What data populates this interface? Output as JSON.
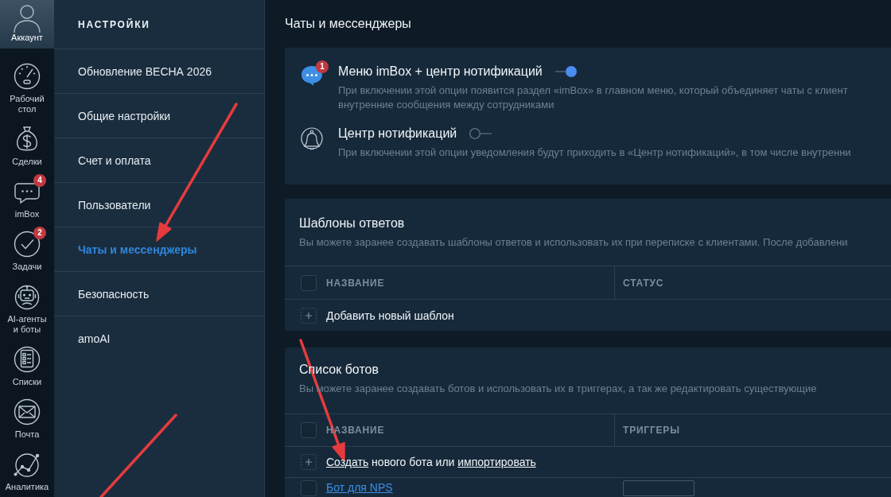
{
  "rail": {
    "account": {
      "label": "Аккаунт"
    },
    "items": [
      {
        "kind": "dashboard",
        "label": "Рабочий стол"
      },
      {
        "kind": "deals",
        "label": "Сделки"
      },
      {
        "kind": "chats",
        "label": "imBox",
        "badge": "4"
      },
      {
        "kind": "tasks",
        "label": "Задачи",
        "badge": "2"
      },
      {
        "kind": "ai",
        "label": "AI-агенты и боты"
      },
      {
        "kind": "lists",
        "label": "Списки"
      },
      {
        "kind": "mail",
        "label": "Почта"
      },
      {
        "kind": "analytics",
        "label": "Аналитика"
      }
    ]
  },
  "settings": {
    "title": "НАСТРОЙКИ",
    "items": [
      {
        "label": "Обновление ВЕСНА 2026",
        "selected": false
      },
      {
        "label": "Общие настройки",
        "selected": false
      },
      {
        "label": "Счет и оплата",
        "selected": false
      },
      {
        "label": "Пользователи",
        "selected": false
      },
      {
        "label": "Чаты и мессенджеры",
        "selected": true
      },
      {
        "label": "Безопасность",
        "selected": false
      },
      {
        "label": "amoAI",
        "selected": false
      }
    ]
  },
  "page": {
    "title": "Чаты и мессенджеры"
  },
  "options": [
    {
      "kind": "chats",
      "badge": "1",
      "title": "Меню imBox + центр нотификаций",
      "on": true,
      "description": [
        "При включении этой опции появится раздел «imBox» в главном меню, который объединяет чаты с клиент",
        "внутренние сообщения между сотрудниками"
      ]
    },
    {
      "kind": "bell",
      "title": "Центр нотификаций",
      "on": false,
      "description": [
        "При включении этой опции уведомления будут приходить в «Центр нотификаций», в том числе внутренни"
      ]
    }
  ],
  "templates": {
    "title": "Шаблоны ответов",
    "description": "Вы можете заранее создавать шаблоны ответов и использовать их при переписке с клиентами. После добавлени",
    "columns": [
      "НАЗВАНИЕ",
      "СТАТУС"
    ],
    "header_checked": false,
    "add_label": "Добавить новый шаблон"
  },
  "bots": {
    "title": "Список ботов",
    "description": "Вы можете заранее создавать ботов и использовать их в триггерах, а так же редактировать существующие",
    "columns": [
      "НАЗВАНИЕ",
      "ТРИГГЕРЫ"
    ],
    "header_checked": false,
    "add_parts": [
      {
        "kind": "link",
        "text": "Создать"
      },
      {
        "kind": "text",
        "text": " нового бота или "
      },
      {
        "kind": "link",
        "text": "импортировать"
      }
    ],
    "rows": [
      {
        "name": "Бот для NPS",
        "checked": false,
        "has_tag": true
      }
    ]
  },
  "annotations": [
    {
      "kind": "arrow"
    },
    {
      "kind": "arrow"
    },
    {
      "kind": "line"
    }
  ]
}
